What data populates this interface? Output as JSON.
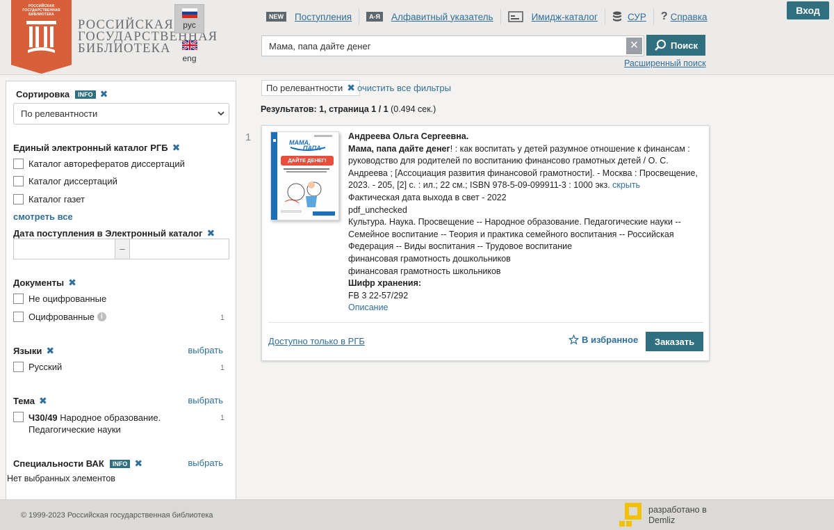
{
  "brand": {
    "name_lines": [
      "Российская",
      "государственная",
      "библиотека"
    ],
    "badge_small": "РОССИЙСКАЯ ГОСУДАРСТВЕННАЯ БИБЛИОТЕКА"
  },
  "lang": {
    "ru": "рус",
    "en": "eng"
  },
  "nav": [
    {
      "badge": "NEW",
      "label": "Поступления",
      "icon": "new-badge-icon"
    },
    {
      "badge": "А-Я",
      "label": "Алфавитный указатель",
      "icon": "alphabet-index-icon"
    },
    {
      "label": "Имидж-каталог",
      "icon": "image-catalog-icon"
    },
    {
      "label": "СУР",
      "icon": "database-icon"
    },
    {
      "label": "Справка",
      "icon": "help-icon"
    }
  ],
  "search": {
    "value": "Мама, папа дайте денег",
    "button": "Поиск",
    "advanced": "Расширенный поиск"
  },
  "login": "Вход",
  "sidebar": {
    "sort": {
      "title": "Сортировка",
      "info": "INFO",
      "selected": "По релевантности"
    },
    "catalog": {
      "title": "Единый электронный каталог РГБ",
      "items": [
        "Каталог авторефератов диссертаций",
        "Каталог диссертаций",
        "Каталог газет"
      ],
      "see_all": "смотреть все"
    },
    "date": {
      "title": "Дата поступления в Электронный каталог",
      "sep": "–"
    },
    "documents": {
      "title": "Документы",
      "items": [
        {
          "label": "Не оцифрованные",
          "count": ""
        },
        {
          "label": "Оцифрованные",
          "count": "1"
        }
      ]
    },
    "languages": {
      "title": "Языки",
      "pick": "выбрать",
      "items": [
        {
          "label": "Русский",
          "count": "1"
        }
      ]
    },
    "topic": {
      "title": "Тема",
      "pick": "выбрать",
      "code": "Ч30/49",
      "line1": "Народное образование.",
      "line2": "Педагогические науки",
      "count": "1"
    },
    "vak": {
      "title": "Специальности ВАК",
      "info": "INFO",
      "pick": "выбрать",
      "empty": "Нет выбранных элементов"
    }
  },
  "filters": {
    "chip": "По релевантности",
    "clear_all": "очистить все фильтры"
  },
  "results": {
    "label": "Результатов:",
    "count": "1",
    "page_label": ", страница",
    "page": "1 / 1",
    "time": "(0.494 сек.)"
  },
  "record": {
    "number": "1",
    "author": "Андреева  Ольга Сергеевна.",
    "title_bold": "Мама, папа дайте денег",
    "line1": "! : как воспитать у детей разумное отношение к финансам :",
    "line2": "руководство для родителей по воспитанию финансово грамотных детей / О. С.",
    "line3": "Андреева ; [Ассоциация развития финансовой грамотности]. - Москва : Просвещение,",
    "line4": "2023. - 205, [2] с. : ил.; 22 см.; ISBN 978-5-09-099911-3 : 1000 экз.",
    "hide": "скрыть",
    "line5": "Фактическая дата выхода в свет - 2022",
    "line6": "pdf_unchecked",
    "line7": "Культура. Наука. Просвещение -- Народное образование. Педагогические науки --",
    "line8": "Семейное воспитание -- Теория и практика семейного воспитания -- Российская",
    "line9": "Федерация -- Виды воспитания -- Трудовое воспитание",
    "line10": "финансовая грамотность дошкольников",
    "line11": "финансовая грамотность школьников",
    "shelf_label": "Шифр хранения:",
    "shelf": "FB 3 22-57/292",
    "description": "Описание",
    "cover": {
      "top": "МАМА,",
      "mid": "ПАПА",
      "big": "ДАЙТЕ ДЕНЕГ!"
    },
    "availability": "Доступно только в РГБ",
    "favorite": "В избранное",
    "order": "Заказать"
  },
  "footer": {
    "copyright": "© 1999-2023 Российская государственная библиотека",
    "dev_line1": "разработано в",
    "dev_line2": "Demliz"
  },
  "colors": {
    "accent": "#2f6f80",
    "link": "#2f6f9a",
    "logo": "#d75f3a"
  }
}
